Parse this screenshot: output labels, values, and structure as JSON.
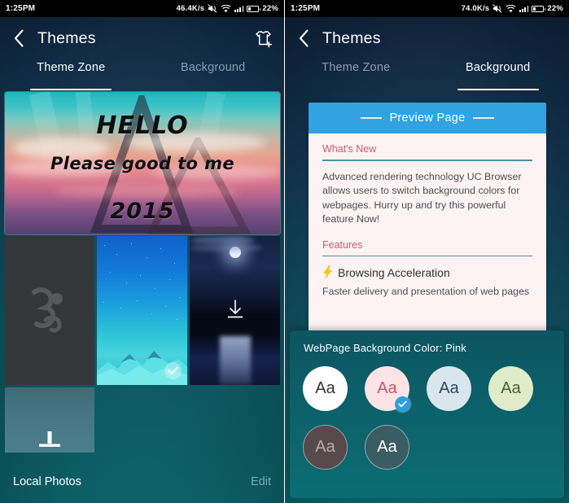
{
  "left": {
    "status": {
      "time": "1:25PM",
      "speed": "46.4K/s",
      "battery": "22%",
      "icons": [
        "mute-icon",
        "wifi-icon",
        "signal-bars-icon",
        "battery-icon"
      ]
    },
    "appbar": {
      "back": "back-chevron-icon",
      "title": "Themes",
      "action": "add-theme-icon"
    },
    "tabs": [
      {
        "label": "Theme Zone",
        "active": true
      },
      {
        "label": "Background",
        "active": false
      }
    ],
    "hero": {
      "line1": "HELLO",
      "line2": "Please good to me",
      "line3": "2015"
    },
    "thumbs": [
      {
        "name": "uc-browser-default",
        "label": ""
      },
      {
        "name": "mountain-night-wallpaper",
        "selected": true
      },
      {
        "name": "moonlit-sea-wallpaper",
        "download": true
      },
      {
        "name": "local-photos-picker",
        "upload": true
      }
    ],
    "bottom": {
      "local_photos": "Local Photos",
      "edit": "Edit"
    }
  },
  "right": {
    "status": {
      "time": "1:25PM",
      "speed": "74.0K/s",
      "battery": "22%",
      "icons": [
        "mute-icon",
        "wifi-icon",
        "signal-bars-icon",
        "battery-icon"
      ]
    },
    "appbar": {
      "back": "back-chevron-icon",
      "title": "Themes"
    },
    "tabs": [
      {
        "label": "Theme Zone",
        "active": false
      },
      {
        "label": "Background",
        "active": true
      }
    ],
    "card": {
      "header": "Preview Page",
      "whats_new_heading": "What's New",
      "whats_new_body": "Advanced rendering technology UC Browser allows users to switch background colors for webpages. Hurry up and try this powerful feature Now!",
      "features_heading": "Features",
      "feature_icon": "lightning-bolt-icon",
      "feature_title": "Browsing Acceleration",
      "feature_body": "Faster delivery and presentation of web pages"
    },
    "sheet": {
      "title": "WebPage Background Color: Pink",
      "swatch_label": "Aa",
      "swatches": [
        {
          "name": "white",
          "bg": "#ffffff",
          "fg": "#333333",
          "selected": false
        },
        {
          "name": "pink",
          "bg": "#fbe3e6",
          "fg": "#c2566d",
          "selected": true
        },
        {
          "name": "light-blue",
          "bg": "#d9e6ee",
          "fg": "#2b4a66",
          "selected": false
        },
        {
          "name": "light-green",
          "bg": "#dfecc9",
          "fg": "#4b5f2b",
          "selected": false
        },
        {
          "name": "dark-brown",
          "bg": "#574a4c",
          "fg": "#b7aaa9",
          "selected": false
        },
        {
          "name": "dark-teal",
          "bg": "#3a5d63",
          "fg": "#ffffff",
          "selected": false
        }
      ]
    }
  }
}
